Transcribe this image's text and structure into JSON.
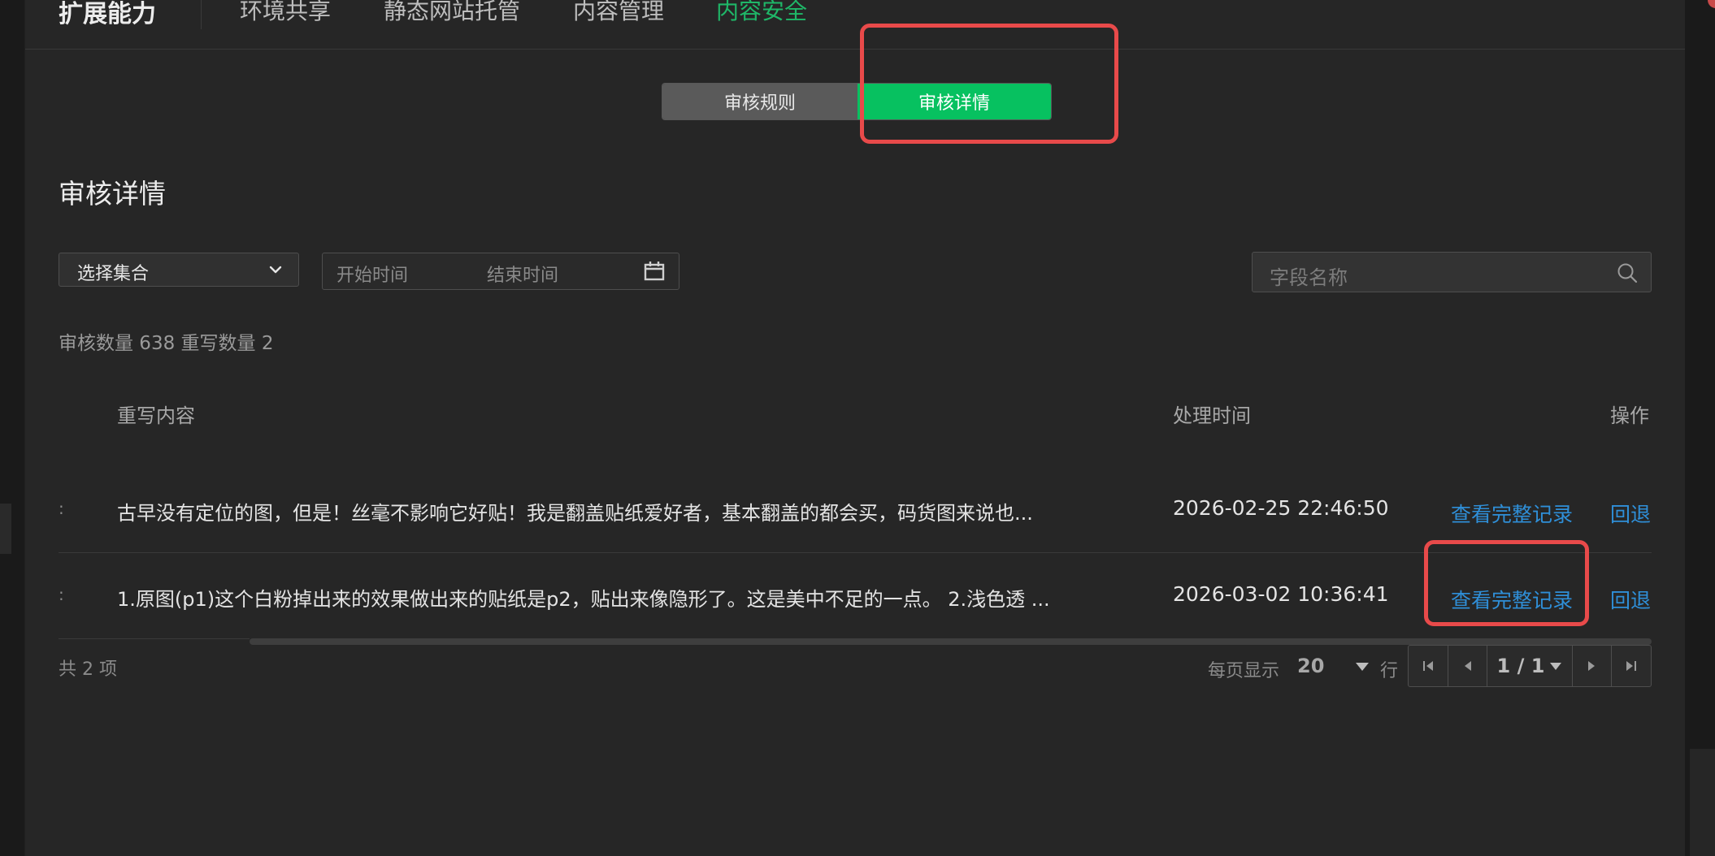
{
  "nav": {
    "brand": "扩展能力",
    "items": [
      {
        "label": "环境共享"
      },
      {
        "label": "静态网站托管"
      },
      {
        "label": "内容管理"
      },
      {
        "label": "内容安全"
      }
    ],
    "active_color": "#1fb768"
  },
  "segmented": {
    "left": "审核规则",
    "right": "审核详情",
    "active_color": "#07c160"
  },
  "section_title": "审核详情",
  "filters": {
    "collection_select": "选择集合",
    "start_placeholder": "开始时间",
    "end_placeholder": "结束时间",
    "search_placeholder": "字段名称"
  },
  "stats": "审核数量 638 重写数量 2",
  "table": {
    "headers": {
      "content": "重写内容",
      "time": "处理时间",
      "action": "操作"
    },
    "rows": [
      {
        "content": "古早没有定位的图，但是！丝毫不影响它好贴！我是翻盖贴纸爱好者，基本翻盖的都会买，码货图来说也...",
        "time": "2026-02-25 22:46:50",
        "view": "查看完整记录",
        "rollback": "回退"
      },
      {
        "content": "1.原图(p1)这个白粉掉出来的效果做出来的贴纸是p2，贴出来像隐形了。这是美中不足的一点。 2.浅色透 ...",
        "time": "2026-03-02 10:36:41",
        "view": "查看完整记录",
        "rollback": "回退"
      }
    ],
    "link_color": "#2f8fd8"
  },
  "pagination": {
    "total": "共 2 项",
    "per_page_label": "每页显示",
    "per_page_value": "20",
    "per_page_unit": "行",
    "page_indicator": "1 / 1"
  },
  "annotation_color": "#e84a4a"
}
